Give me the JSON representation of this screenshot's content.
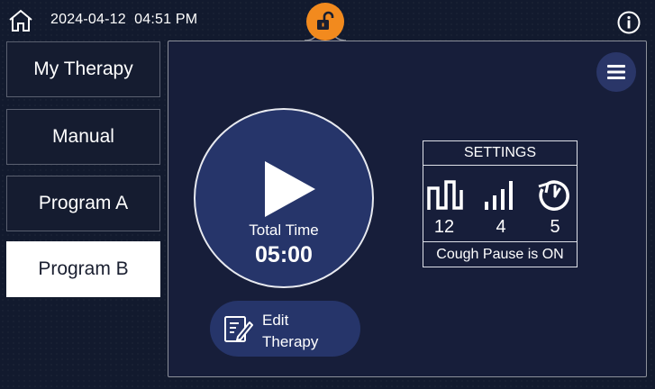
{
  "header": {
    "date": "2024-04-12",
    "time": "04:51 PM",
    "lock_state": "unlocked",
    "colors": {
      "lock_badge": "#f28a1e",
      "background": "#121a2e"
    }
  },
  "nav": {
    "items": [
      {
        "label": "My Therapy",
        "active": false
      },
      {
        "label": "Manual",
        "active": false
      },
      {
        "label": "Program A",
        "active": false
      },
      {
        "label": "Program B",
        "active": true
      }
    ]
  },
  "main": {
    "total_time_label": "Total Time",
    "total_time_value": "05:00",
    "edit_button": {
      "line1": "Edit",
      "line2": "Therapy"
    }
  },
  "settings": {
    "title": "SETTINGS",
    "values": [
      {
        "icon": "frequency-wave-icon",
        "value": "12"
      },
      {
        "icon": "intensity-bars-icon",
        "value": "4"
      },
      {
        "icon": "cycle-timer-icon",
        "value": "5"
      }
    ],
    "footer": "Cough Pause is ON"
  }
}
